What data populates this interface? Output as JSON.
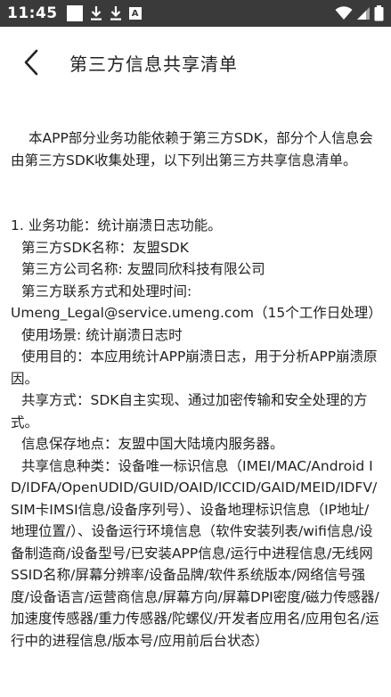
{
  "status_bar": {
    "time": "11:45",
    "icons": [
      "square-notification-icon",
      "download-icon",
      "download-icon",
      "a-notification-icon",
      "wifi-icon",
      "signal-icon",
      "battery-icon"
    ]
  },
  "header": {
    "title": "第三方信息共享清单",
    "back_icon": "chevron-left-icon"
  },
  "content": {
    "intro": "本APP部分业务功能依赖于第三方SDK，部分个人信息会由第三方SDK收集处理，以下列出第三方共享信息清单。",
    "item": {
      "function": "1. 业务功能：统计崩溃日志功能。",
      "sdk_name": "第三方SDK名称：友盟SDK",
      "company": "第三方公司名称: 友盟同欣科技有限公司",
      "contact_label": "第三方联系方式和处理时间:",
      "contact_value": "Umeng_Legal@service.umeng.com（15个工作日处理）",
      "scenario": "使用场景: 统计崩溃日志时",
      "purpose": "使用目的：本应用统计APP崩溃日志，用于分析APP崩溃原因。",
      "method": "共享方式：SDK自主实现、通过加密传输和安全处理的方式。",
      "storage": "信息保存地点：友盟中国大陆境内服务器。",
      "info_types": "共享信息种类：设备唯一标识信息（IMEI/MAC/Android ID/IDFA/OpenUDID/GUID/OAID/ICCID/GAID/MEID/IDFV/SIM卡IMSI信息/设备序列号）、设备地理标识信息（IP地址/地理位置/）、设备运行环境信息（软件安装列表/wifi信息/设备制造商/设备型号/已安装APP信息/运行中进程信息/无线网SSID名称/屏幕分辨率/设备品牌/软件系统版本/网络信号强度/设备语言/运营商信息/屏幕方向/屏幕DPI密度/磁力传感器/加速度传感器/重力传感器/陀螺仪/开发者应用名/应用包名/运行中的进程信息/版本号/应用前后台状态）"
    }
  }
}
